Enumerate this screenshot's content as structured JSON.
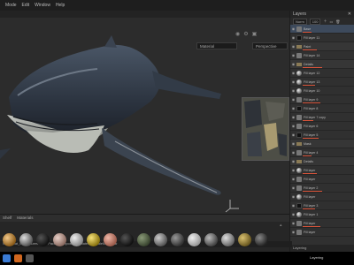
{
  "menu": [
    "Mode",
    "Edit",
    "Window",
    "Help"
  ],
  "viewport": {
    "material_dropdown": "Material",
    "view_dropdown": "Perspective"
  },
  "layers": {
    "title": "Layers",
    "blend_mode": "Norm",
    "opacity": "100",
    "rows": [
      {
        "name": "Base",
        "kind": "sel",
        "thumb": "grey"
      },
      {
        "name": "Fill layer 11",
        "kind": "row",
        "thumb": "black"
      },
      {
        "name": "Paint",
        "kind": "folder",
        "thumb": "fold"
      },
      {
        "name": "Fill layer 14",
        "kind": "row",
        "thumb": "grey"
      },
      {
        "name": "Details",
        "kind": "folder",
        "thumb": "fold"
      },
      {
        "name": "Fill layer 12",
        "kind": "row",
        "thumb": "sphere"
      },
      {
        "name": "Fill layer 13",
        "kind": "row",
        "thumb": "sphere"
      },
      {
        "name": "Fill layer 10",
        "kind": "row",
        "thumb": "sphere"
      },
      {
        "name": "Fill layer 9",
        "kind": "row",
        "thumb": "grey"
      },
      {
        "name": "Fill layer 8",
        "kind": "row",
        "thumb": "black"
      },
      {
        "name": "Fill layer 7 copy",
        "kind": "row",
        "thumb": "grey"
      },
      {
        "name": "Fill layer 6",
        "kind": "row",
        "thumb": "grey"
      },
      {
        "name": "Fill layer 5",
        "kind": "row",
        "thumb": "black"
      },
      {
        "name": "Mask",
        "kind": "folder",
        "thumb": "fold"
      },
      {
        "name": "Fill layer 4",
        "kind": "row",
        "thumb": "grey"
      },
      {
        "name": "Details",
        "kind": "folder",
        "thumb": "fold"
      },
      {
        "name": "Fill layer",
        "kind": "row",
        "thumb": "sphere"
      },
      {
        "name": "Fill layer",
        "kind": "row",
        "thumb": "grey"
      },
      {
        "name": "Fill layer 2",
        "kind": "row",
        "thumb": "grey"
      },
      {
        "name": "Fill layer",
        "kind": "row",
        "thumb": "sphere"
      },
      {
        "name": "Fill layer 3",
        "kind": "row",
        "thumb": "black"
      },
      {
        "name": "Fill layer 1",
        "kind": "row",
        "thumb": "sphere"
      },
      {
        "name": "Fill layer",
        "kind": "row",
        "thumb": "grey"
      },
      {
        "name": "Fill layer",
        "kind": "row",
        "thumb": "grey"
      }
    ],
    "footer": "Layering"
  },
  "shelf": {
    "tabs": [
      "Shelf",
      "Materials"
    ],
    "path": "WhaleMat_02_Textures.sbsar Pacific  Compositions  Material  WhaleMat.sbsar"
  },
  "colors": {
    "accent": "#d9543a",
    "panel": "#303030",
    "viewport": "#2c2c2c"
  }
}
